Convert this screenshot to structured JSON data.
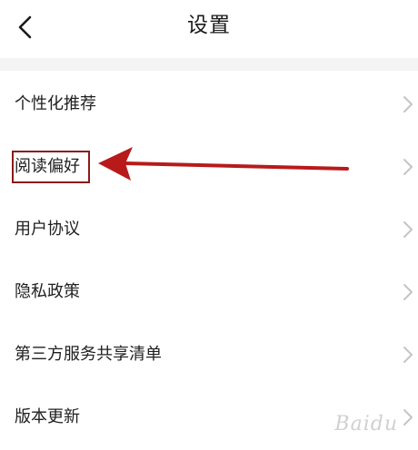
{
  "header": {
    "title": "设置",
    "back_icon": "chevron-left-icon"
  },
  "settings": {
    "items": [
      {
        "label": "个性化推荐"
      },
      {
        "label": "阅读偏好"
      },
      {
        "label": "用户协议"
      },
      {
        "label": "隐私政策"
      },
      {
        "label": "第三方服务共享清单"
      },
      {
        "label": "版本更新"
      }
    ]
  },
  "annotation": {
    "highlight_color": "#8b1a1a",
    "arrow_color": "#b81a1a"
  },
  "watermark": {
    "text": "Baidu"
  },
  "colors": {
    "background": "#ffffff",
    "divider": "#f4f4f4",
    "text": "#1f1f1f",
    "chevron": "#c4c4c4"
  }
}
